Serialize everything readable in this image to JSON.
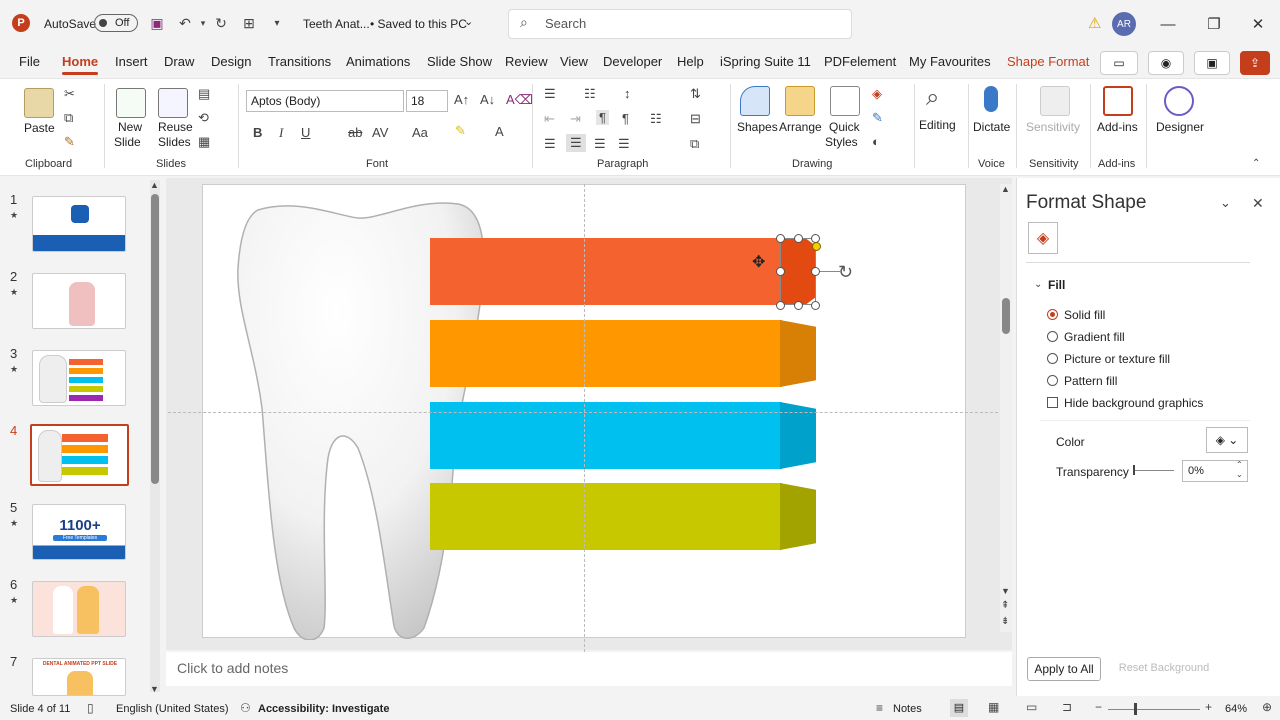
{
  "titlebar": {
    "logo": "P",
    "autosave_label": "AutoSave",
    "autosave_state": "Off",
    "doc_title": "Teeth Anat...",
    "saved_status": "• Saved to this PC",
    "search_placeholder": "Search",
    "user_initials": "AR"
  },
  "menu": {
    "items": [
      "File",
      "Home",
      "Insert",
      "Draw",
      "Design",
      "Transitions",
      "Animations",
      "Slide Show",
      "Review",
      "View",
      "Developer",
      "Help",
      "iSpring Suite 11",
      "PDFelement",
      "My Favourites",
      "Shape Format"
    ],
    "active": "Home"
  },
  "ribbon": {
    "clipboard": {
      "paste": "Paste",
      "group": "Clipboard"
    },
    "slides": {
      "new_slide": "New Slide",
      "new_slide_l1": "New",
      "new_slide_l2": "Slide",
      "reuse_l1": "Reuse",
      "reuse_l2": "Slides",
      "group": "Slides"
    },
    "font": {
      "name": "Aptos (Body)",
      "size": "18",
      "group": "Font",
      "bold": "B",
      "italic": "I",
      "underline": "U",
      "strike": "ab",
      "spacing": "AV",
      "case": "Aa",
      "color": "A"
    },
    "paragraph": {
      "group": "Paragraph"
    },
    "drawing": {
      "shapes": "Shapes",
      "arrange": "Arrange",
      "quick_l1": "Quick",
      "quick_l2": "Styles",
      "group": "Drawing"
    },
    "editing": {
      "label": "Editing"
    },
    "voice": {
      "dictate": "Dictate",
      "group": "Voice"
    },
    "sensitivity": {
      "label": "Sensitivity",
      "group": "Sensitivity"
    },
    "addins": {
      "label": "Add-ins",
      "group": "Add-ins"
    },
    "designer": {
      "label": "Designer"
    }
  },
  "slides": [
    {
      "num": "1",
      "star": "★"
    },
    {
      "num": "2",
      "star": "★"
    },
    {
      "num": "3",
      "star": "★"
    },
    {
      "num": "4",
      "star": ""
    },
    {
      "num": "5",
      "star": "★",
      "thumb_text": "1100+",
      "thumb_sub": "Free Templates"
    },
    {
      "num": "6",
      "star": "★"
    },
    {
      "num": "7",
      "star": "",
      "thumb_text": "DENTAL ANIMATED PPT SLIDE"
    }
  ],
  "selected_slide": "4",
  "canvas": {
    "bar_colors": [
      "#f4622f",
      "#ff9800",
      "#00c0ef",
      "#c8c800"
    ],
    "cap_colors": [
      "#e24a12",
      "#d87f06",
      "#00a2cc",
      "#a3a300"
    ]
  },
  "notes": {
    "placeholder": "Click to add notes"
  },
  "format_pane": {
    "title": "Format Shape",
    "section": "Fill",
    "options": [
      "Solid fill",
      "Gradient fill",
      "Picture or texture fill",
      "Pattern fill"
    ],
    "selected": "Solid fill",
    "hide_bg": "Hide background graphics",
    "color_label": "Color",
    "transparency_label": "Transparency",
    "transparency_value": "0%",
    "apply_all": "Apply to All",
    "reset_bg": "Reset Background"
  },
  "status": {
    "slide_info": "Slide 4 of 11",
    "language": "English (United States)",
    "accessibility": "Accessibility: Investigate",
    "notes": "Notes",
    "zoom": "64%"
  }
}
